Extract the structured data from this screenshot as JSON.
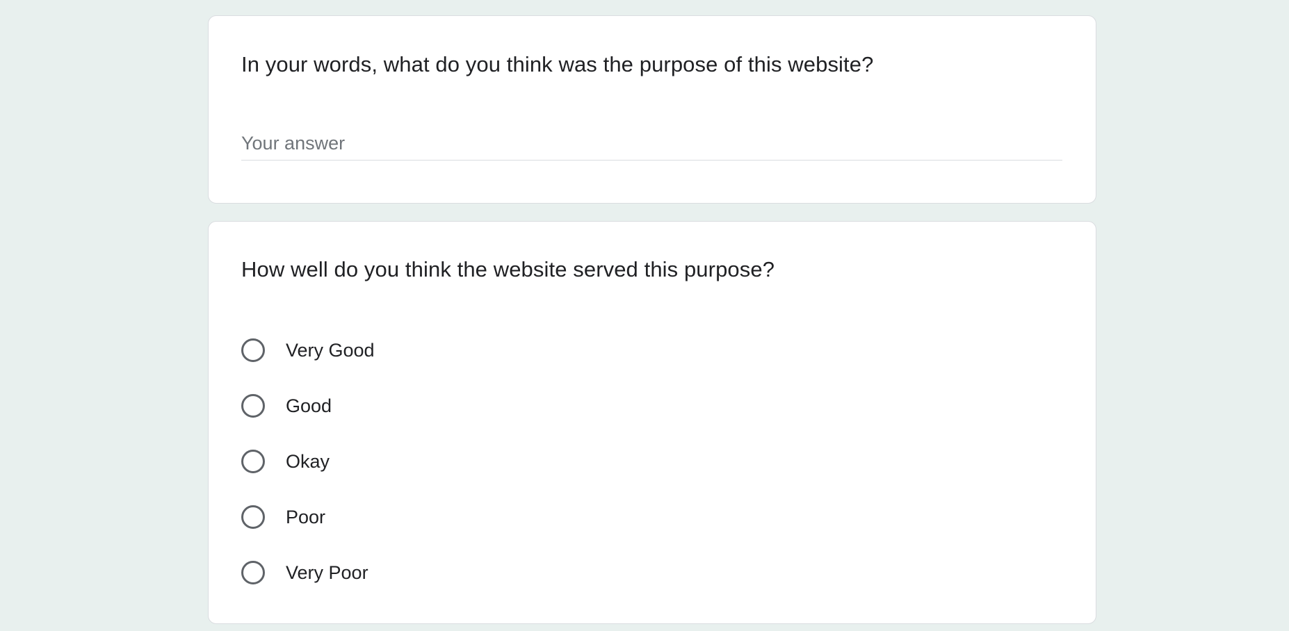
{
  "questions": [
    {
      "title": "In your words, what do you think was the purpose of this website?",
      "type": "short-answer",
      "placeholder": "Your answer",
      "value": ""
    },
    {
      "title": "How well do you think the website served this purpose?",
      "type": "multiple-choice",
      "options": [
        "Very Good",
        "Good",
        "Okay",
        "Poor",
        "Very Poor"
      ],
      "selected": null
    }
  ],
  "colors": {
    "page_background": "#e8f0ee",
    "card_background": "#ffffff",
    "card_border": "#dadce0",
    "text": "#202124",
    "placeholder": "#70757a",
    "radio_outline": "#5f6368"
  },
  "icons": [
    "radio-unchecked-icon"
  ]
}
